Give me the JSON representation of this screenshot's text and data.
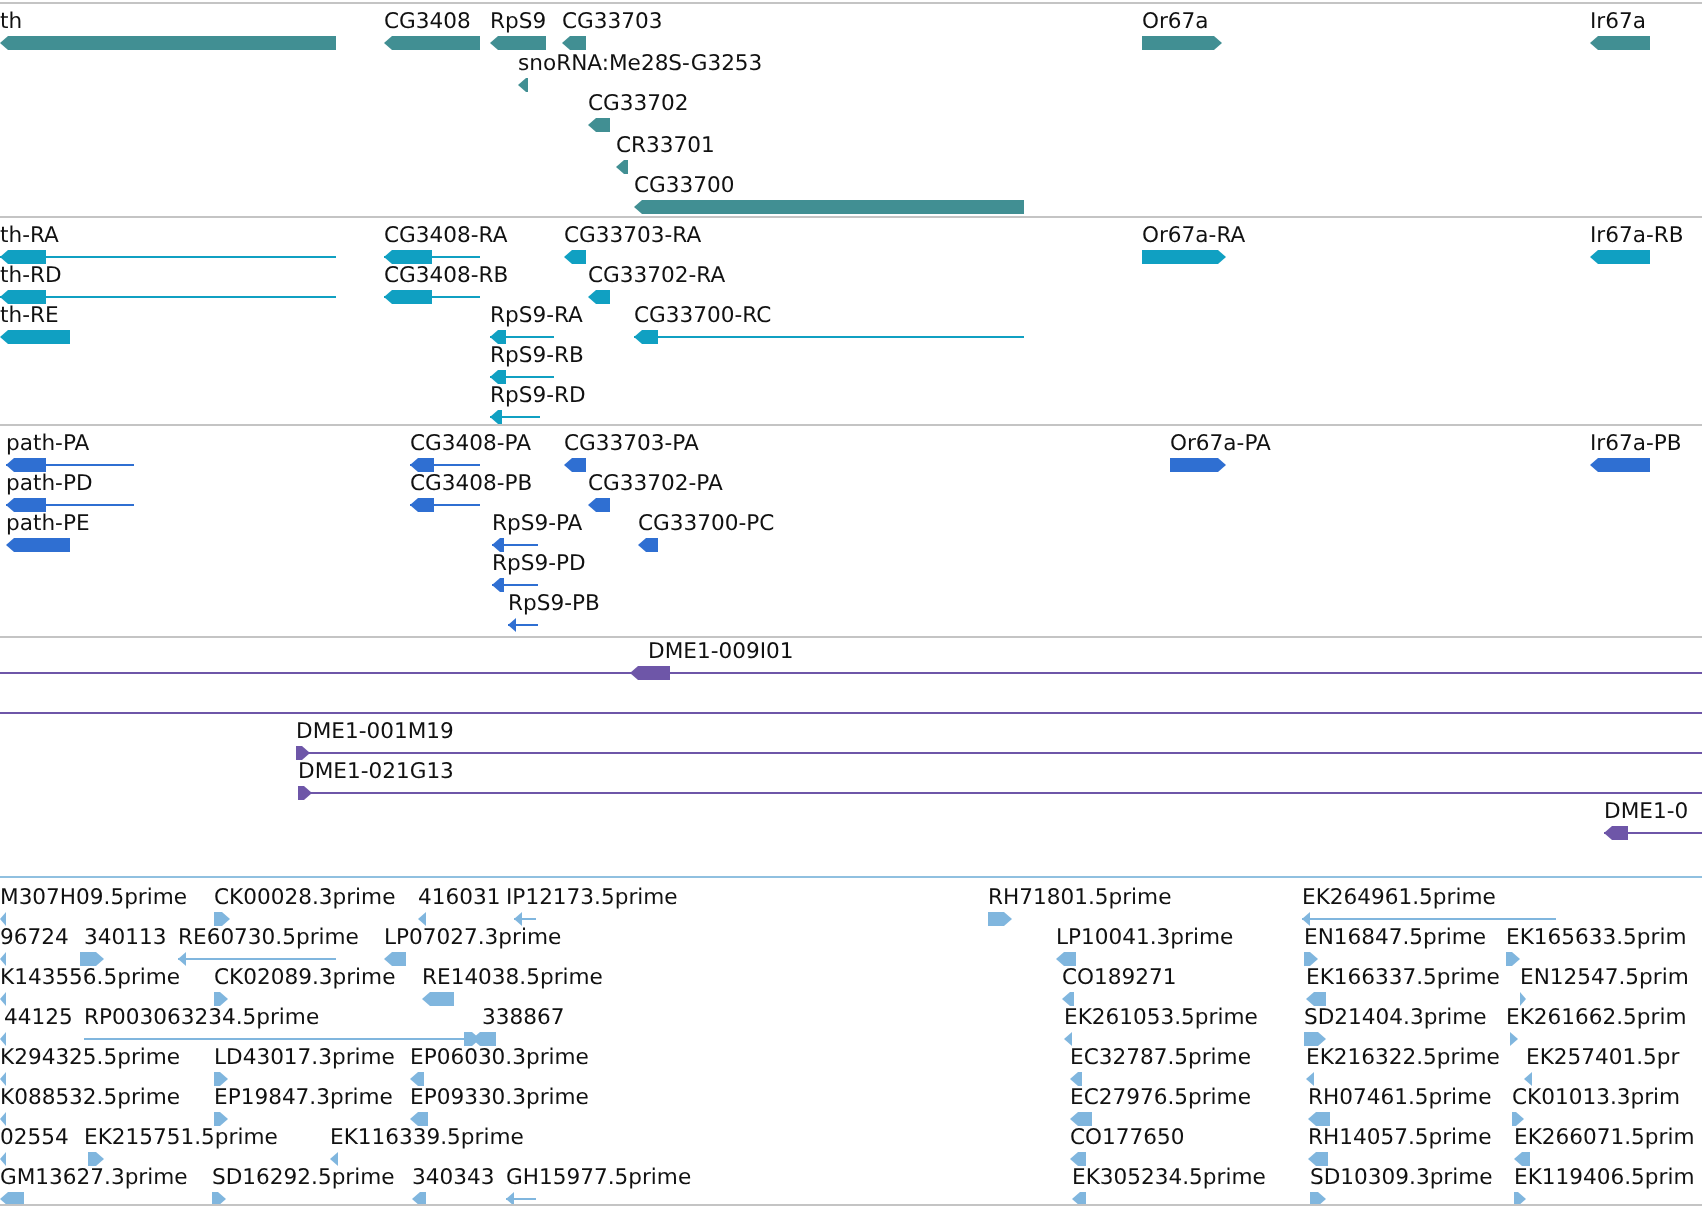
{
  "tracks": [
    {
      "kind": "gene",
      "features": [
        {
          "label": "th",
          "reverse": true
        },
        {
          "label": "CG3408",
          "reverse": true
        },
        {
          "label": "RpS9",
          "reverse": true
        },
        {
          "label": "CG33703",
          "reverse": true
        },
        {
          "label": "Or67a",
          "reverse": false
        },
        {
          "label": "Ir67a",
          "reverse": true
        },
        {
          "label": "snoRNA:Me28S-G3253",
          "reverse": true
        },
        {
          "label": "CG33702",
          "reverse": true
        },
        {
          "label": "CR33701",
          "reverse": true
        },
        {
          "label": "CG33700",
          "reverse": true
        }
      ]
    },
    {
      "kind": "transcript",
      "features": [
        {
          "label": "th-RA",
          "reverse": true
        },
        {
          "label": "CG3408-RA",
          "reverse": true
        },
        {
          "label": "CG33703-RA",
          "reverse": true
        },
        {
          "label": "Or67a-RA",
          "reverse": false
        },
        {
          "label": "Ir67a-RB",
          "reverse": true
        },
        {
          "label": "th-RD",
          "reverse": true
        },
        {
          "label": "CG3408-RB",
          "reverse": true
        },
        {
          "label": "CG33702-RA",
          "reverse": true
        },
        {
          "label": "th-RE",
          "reverse": true
        },
        {
          "label": "RpS9-RA",
          "reverse": true
        },
        {
          "label": "CG33700-RC",
          "reverse": true
        },
        {
          "label": "RpS9-RB",
          "reverse": true
        },
        {
          "label": "RpS9-RD",
          "reverse": true
        }
      ]
    },
    {
      "kind": "protein",
      "features": [
        {
          "label": "path-PA",
          "reverse": true
        },
        {
          "label": "CG3408-PA",
          "reverse": true
        },
        {
          "label": "CG33703-PA",
          "reverse": true
        },
        {
          "label": "Or67a-PA",
          "reverse": false
        },
        {
          "label": "Ir67a-PB",
          "reverse": true
        },
        {
          "label": "path-PD",
          "reverse": true
        },
        {
          "label": "CG3408-PB",
          "reverse": true
        },
        {
          "label": "CG33702-PA",
          "reverse": true
        },
        {
          "label": "path-PE",
          "reverse": true
        },
        {
          "label": "RpS9-PA",
          "reverse": true
        },
        {
          "label": "CG33700-PC",
          "reverse": true
        },
        {
          "label": "RpS9-PD",
          "reverse": true
        },
        {
          "label": "RpS9-PB",
          "reverse": true
        }
      ]
    },
    {
      "kind": "clone",
      "features": [
        {
          "kind": "clone",
          "label": "DME1-009I01",
          "reverse": true
        },
        {
          "kind": "span"
        },
        {
          "kind": "clone",
          "label": "DME1-001M19",
          "reverse": false
        },
        {
          "kind": "clone",
          "label": "DME1-021G13",
          "reverse": false
        },
        {
          "kind": "clone",
          "label": "DME1-0",
          "reverse": true
        }
      ]
    },
    {
      "kind": "est",
      "features": [
        {
          "label": "M307H09.5prime",
          "reverse": true
        },
        {
          "label": "CK00028.3prime",
          "reverse": false
        },
        {
          "label": "416031",
          "reverse": true
        },
        {
          "label": "IP12173.5prime",
          "reverse": true
        },
        {
          "label": "RH71801.5prime",
          "reverse": false
        },
        {
          "label": "EK264961.5prime",
          "reverse": true
        },
        {
          "label": "96724",
          "reverse": true
        },
        {
          "label": "340113",
          "reverse": false
        },
        {
          "label": "RE60730.5prime",
          "reverse": true
        },
        {
          "label": "LP07027.3prime",
          "reverse": true
        },
        {
          "label": "LP10041.3prime",
          "reverse": true
        },
        {
          "label": "EN16847.5prime",
          "reverse": false
        },
        {
          "label": "EK165633.5prim",
          "reverse": false
        },
        {
          "label": "K143556.5prime",
          "reverse": true
        },
        {
          "label": "CK02089.3prime",
          "reverse": false
        },
        {
          "label": "RE14038.5prime",
          "reverse": true
        },
        {
          "label": "CO189271",
          "reverse": true
        },
        {
          "label": "EK166337.5prime",
          "reverse": true
        },
        {
          "label": "EN12547.5prim",
          "reverse": false
        },
        {
          "label": "44125",
          "reverse": true
        },
        {
          "label": "RP003063234.5prime",
          "reverse": false
        },
        {
          "label": "338867",
          "reverse": true
        },
        {
          "label": "EK261053.5prime",
          "reverse": true
        },
        {
          "label": "SD21404.3prime",
          "reverse": false
        },
        {
          "label": "EK261662.5prim",
          "reverse": false
        },
        {
          "label": "K294325.5prime",
          "reverse": true
        },
        {
          "label": "LD43017.3prime",
          "reverse": false
        },
        {
          "label": "EP06030.3prime",
          "reverse": true
        },
        {
          "label": "EC32787.5prime",
          "reverse": true
        },
        {
          "label": "EK216322.5prime",
          "reverse": true
        },
        {
          "label": "EK257401.5pr",
          "reverse": true
        },
        {
          "label": "K088532.5prime",
          "reverse": true
        },
        {
          "label": "EP19847.3prime",
          "reverse": false
        },
        {
          "label": "EP09330.3prime",
          "reverse": true
        },
        {
          "label": "EC27976.5prime",
          "reverse": true
        },
        {
          "label": "RH07461.5prime",
          "reverse": true
        },
        {
          "label": "CK01013.3prim",
          "reverse": false
        },
        {
          "label": "02554",
          "reverse": true
        },
        {
          "label": "EK215751.5prime",
          "reverse": false
        },
        {
          "label": "EK116339.5prime",
          "reverse": true
        },
        {
          "label": "CO177650",
          "reverse": true
        },
        {
          "label": "RH14057.5prime",
          "reverse": true
        },
        {
          "label": "EK266071.5prim",
          "reverse": true
        },
        {
          "label": "GM13627.3prime",
          "reverse": true
        },
        {
          "label": "SD16292.5prime",
          "reverse": false
        },
        {
          "label": "340343",
          "reverse": true
        },
        {
          "label": "GH15977.5prime",
          "reverse": true
        },
        {
          "label": "EK305234.5prime",
          "reverse": true
        },
        {
          "label": "SD10309.3prime",
          "reverse": false
        },
        {
          "label": "EK119406.5prim",
          "reverse": false
        }
      ]
    }
  ]
}
